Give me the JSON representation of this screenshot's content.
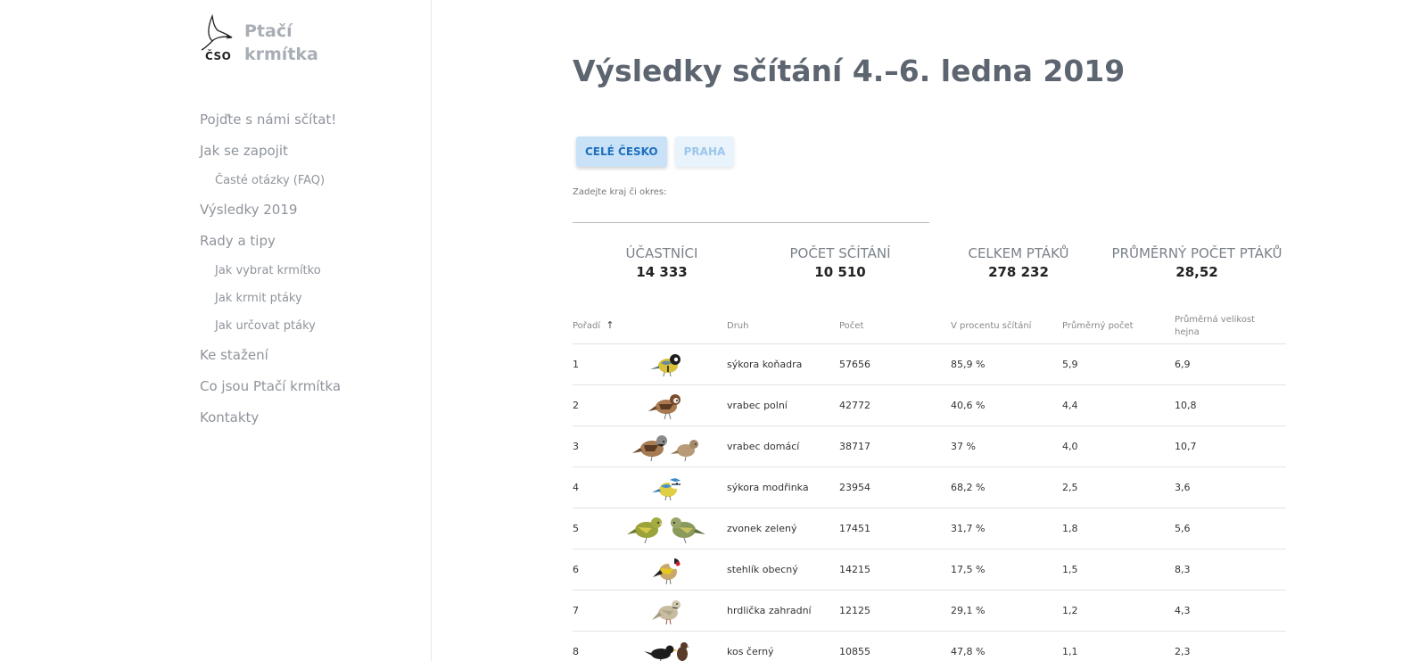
{
  "brand": {
    "name_line1": "Ptačí",
    "name_line2": "krmítka",
    "org": "ČSO"
  },
  "sidebar": {
    "items": [
      {
        "label": "Pojďte s námi sčítat!",
        "level": 1
      },
      {
        "label": "Jak se zapojit",
        "level": 1
      },
      {
        "label": "Časté otázky (FAQ)",
        "level": 2
      },
      {
        "label": "Výsledky 2019",
        "level": 1
      },
      {
        "label": "Rady a tipy",
        "level": 1
      },
      {
        "label": "Jak vybrat krmítko",
        "level": 2
      },
      {
        "label": "Jak krmit ptáky",
        "level": 2
      },
      {
        "label": "Jak určovat ptáky",
        "level": 2
      },
      {
        "label": "Ke stažení",
        "level": 1
      },
      {
        "label": "Co jsou Ptačí krmítka",
        "level": 1
      },
      {
        "label": "Kontakty",
        "level": 1
      }
    ]
  },
  "main": {
    "title": "Výsledky sčítání 4.–6. ledna 2019",
    "region_buttons": [
      {
        "label": "CELÉ ČESKO",
        "active": true
      },
      {
        "label": "PRAHA",
        "active": false
      }
    ],
    "search": {
      "label": "Zadejte kraj či okres:",
      "value": "",
      "placeholder": ""
    },
    "stats": [
      {
        "label": "ÚČASTNÍCI",
        "value": "14 333"
      },
      {
        "label": "POČET SČÍTÁNÍ",
        "value": "10 510"
      },
      {
        "label": "CELKEM PTÁKŮ",
        "value": "278 232"
      },
      {
        "label": "PRŮMĚRNÝ POČET PTÁKŮ",
        "value": "28,52"
      }
    ],
    "table": {
      "headers": {
        "rank": "Pořadí",
        "species": "Druh",
        "count": "Počet",
        "percent": "V procentu sčítání",
        "avg_count": "Průměrný počet",
        "avg_flock_line1": "Průměrná velikost",
        "avg_flock_line2": "hejna"
      },
      "sort_indicator": "↑",
      "rows": [
        {
          "rank": "1",
          "species": "sýkora koňadra",
          "count": "57656",
          "percent": "85,9 %",
          "avg_count": "5,9",
          "avg_flock": "6,9",
          "bird_icon": "great-tit-icon"
        },
        {
          "rank": "2",
          "species": "vrabec polní",
          "count": "42772",
          "percent": "40,6 %",
          "avg_count": "4,4",
          "avg_flock": "10,8",
          "bird_icon": "tree-sparrow-icon"
        },
        {
          "rank": "3",
          "species": "vrabec domácí",
          "count": "38717",
          "percent": "37 %",
          "avg_count": "4,0",
          "avg_flock": "10,7",
          "bird_icon": "house-sparrow-icon"
        },
        {
          "rank": "4",
          "species": "sýkora modřinka",
          "count": "23954",
          "percent": "68,2 %",
          "avg_count": "2,5",
          "avg_flock": "3,6",
          "bird_icon": "blue-tit-icon"
        },
        {
          "rank": "5",
          "species": "zvonek zelený",
          "count": "17451",
          "percent": "31,7 %",
          "avg_count": "1,8",
          "avg_flock": "5,6",
          "bird_icon": "greenfinch-icon"
        },
        {
          "rank": "6",
          "species": "stehlík obecný",
          "count": "14215",
          "percent": "17,5 %",
          "avg_count": "1,5",
          "avg_flock": "8,3",
          "bird_icon": "goldfinch-icon"
        },
        {
          "rank": "7",
          "species": "hrdlička zahradní",
          "count": "12125",
          "percent": "29,1 %",
          "avg_count": "1,2",
          "avg_flock": "4,3",
          "bird_icon": "collared-dove-icon"
        },
        {
          "rank": "8",
          "species": "kos černý",
          "count": "10855",
          "percent": "47,8 %",
          "avg_count": "1,1",
          "avg_flock": "2,3",
          "bird_icon": "blackbird-icon"
        }
      ]
    }
  },
  "colors": {
    "title": "#5d6570",
    "nav": "#8f959c",
    "button_active_bg": "#c9e2f7",
    "button_active_text": "#1f6fbd",
    "button_inactive_bg": "#e9f3fc",
    "button_inactive_text": "#9cc6ec"
  }
}
